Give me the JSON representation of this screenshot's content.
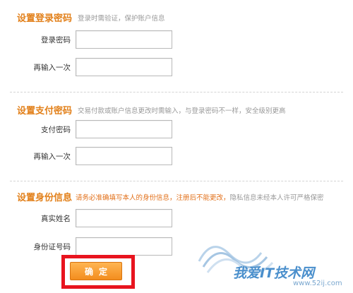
{
  "login": {
    "title": "设置登录密码",
    "desc": "登录时需验证，保护账户信息",
    "rows": [
      {
        "label": "登录密码",
        "value": ""
      },
      {
        "label": "再输入一次",
        "value": ""
      }
    ]
  },
  "payment": {
    "title": "设置支付密码",
    "desc": "交易付款或账户信息更改时需输入，与登录密码不一样，安全级别更高",
    "rows": [
      {
        "label": "支付密码",
        "value": ""
      },
      {
        "label": "再输入一次",
        "value": ""
      }
    ]
  },
  "identity": {
    "title": "设置身份信息",
    "desc_warn": "请务必准确填写本人的身份信息，注册后不能更改，",
    "desc_rest": "隐私信息未经本人许可严格保密",
    "rows": [
      {
        "label": "真实姓名",
        "value": ""
      },
      {
        "label": "身份证号码",
        "value": ""
      }
    ]
  },
  "confirm_button": "确定",
  "watermark": {
    "text": "我爱IT技术网",
    "url": "www.52ij.com"
  },
  "colors": {
    "accent": "#e2801a",
    "highlight": "#e8141e",
    "watermark": "#4a8fcc"
  }
}
